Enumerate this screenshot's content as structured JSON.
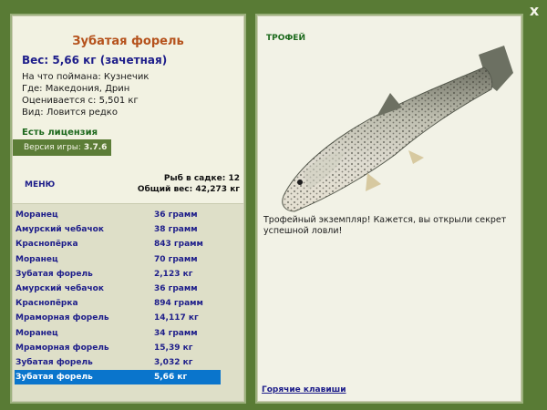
{
  "window": {
    "close_label": "x"
  },
  "fish": {
    "title": "Зубатая форель",
    "weight_line": "Вес: 5,66 кг (зачетная)",
    "bait": "На что поймана: Кузнечик",
    "location": "Где: Македония, Дрин",
    "value": "Оценивается с: 5,501 кг",
    "kind": "Вид: Ловится редко"
  },
  "license": {
    "label": "Есть лицензия"
  },
  "version": {
    "label": "Версия игры:",
    "value": "3.7.6"
  },
  "menu": {
    "label": "МЕНЮ"
  },
  "totals": {
    "count_line": "Рыб в садке: 12",
    "weight_line": "Общий вес: 42,273 кг"
  },
  "catches": [
    {
      "name": "Моранец",
      "weight": "36 грамм"
    },
    {
      "name": "Амурский чебачок",
      "weight": "38 грамм"
    },
    {
      "name": "Краснопёрка",
      "weight": "843 грамм"
    },
    {
      "name": "Моранец",
      "weight": "70 грамм"
    },
    {
      "name": "Зубатая форель",
      "weight": "2,123 кг"
    },
    {
      "name": "Амурский чебачок",
      "weight": "36 грамм"
    },
    {
      "name": "Краснопёрка",
      "weight": "894 грамм"
    },
    {
      "name": "Мраморная форель",
      "weight": "14,117 кг"
    },
    {
      "name": "Моранец",
      "weight": "34 грамм"
    },
    {
      "name": "Мраморная форель",
      "weight": "15,39 кг"
    },
    {
      "name": "Зубатая форель",
      "weight": "3,032 кг"
    },
    {
      "name": "Зубатая форель",
      "weight": "5,66 кг"
    }
  ],
  "selected_index": 11,
  "trophy": {
    "label": "ТРОФЕЙ",
    "description": "Трофейный экземпляр! Кажется, вы открыли секрет успешной ловли!"
  },
  "hotkeys": {
    "label": "Горячие клавиши"
  },
  "colors": {
    "background": "#597b35",
    "panel": "#f2f2e2",
    "accent_title": "#b5521c",
    "link_blue": "#1d1d8a",
    "selection": "#0a75cc"
  }
}
